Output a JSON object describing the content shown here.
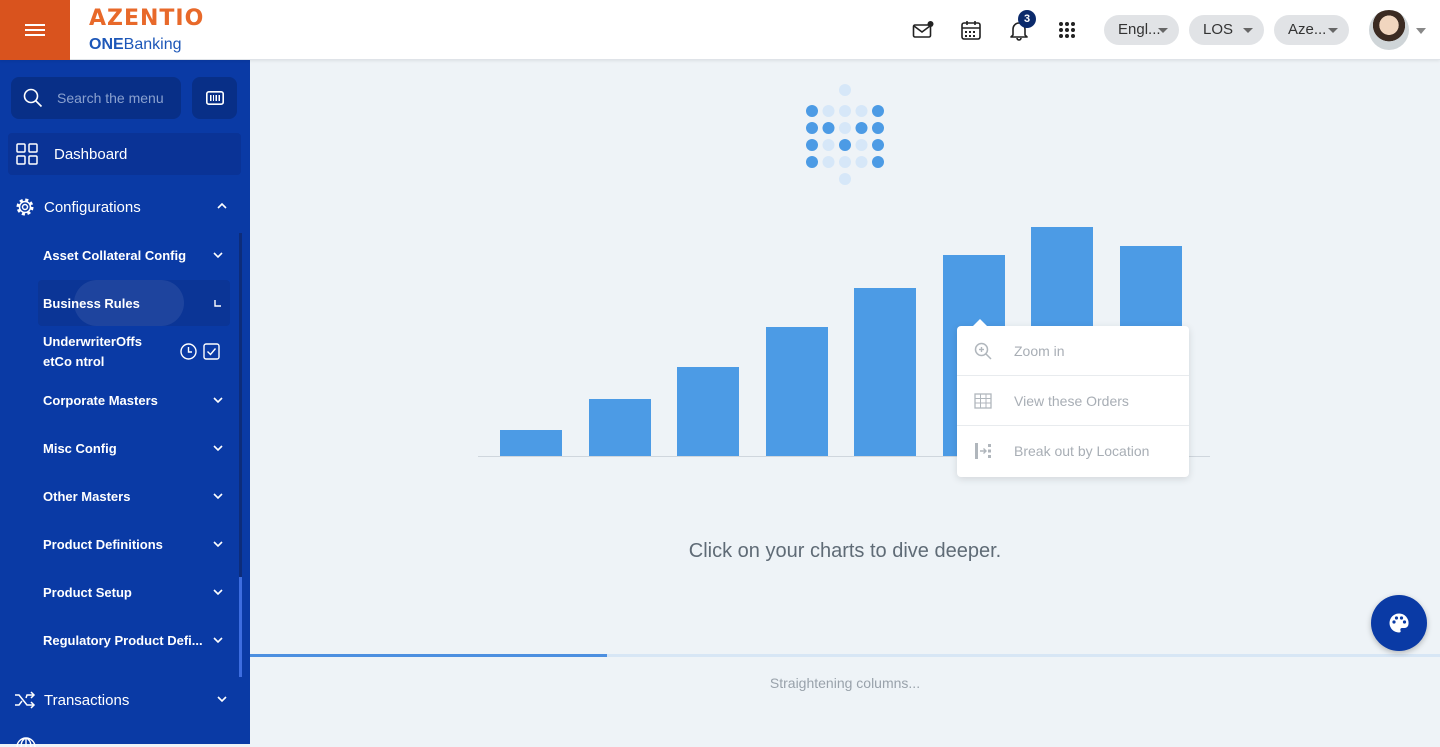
{
  "header": {
    "brand": "AZENTIO",
    "sub_prefix": "ONE",
    "sub_suffix": "Banking",
    "notification_count": "3",
    "language": "Engl...",
    "module": "LOS",
    "entity": "Aze..."
  },
  "sidebar": {
    "search_placeholder": "Search the menu",
    "dashboard": "Dashboard",
    "configurations": "Configurations",
    "items": [
      {
        "label": "Asset Collateral Config"
      },
      {
        "label": "Business Rules"
      },
      {
        "label": "UnderwriterOffsetCo ntrol"
      },
      {
        "label": "Corporate Masters"
      },
      {
        "label": "Misc Config"
      },
      {
        "label": "Other Masters"
      },
      {
        "label": "Product Definitions"
      },
      {
        "label": "Product Setup"
      },
      {
        "label": "Regulatory Product Defi..."
      }
    ],
    "transactions": "Transactions"
  },
  "main": {
    "context_menu": [
      "Zoom in",
      "View these Orders",
      "Break out by Location"
    ],
    "caption": "Click on your charts to dive deeper.",
    "status": "Straightening columns...",
    "progress": 0.3
  },
  "chart_data": {
    "type": "bar",
    "categories": [
      "",
      "",
      "",
      "",
      "",
      "",
      "",
      ""
    ],
    "values": [
      26,
      57,
      89,
      129,
      168,
      201,
      229,
      210
    ],
    "ylim": [
      0,
      240
    ],
    "color": "#4c9be5"
  },
  "colors": {
    "sidebar": "#0a3aa5",
    "accent": "#d9531e",
    "bar": "#4c9be5"
  }
}
